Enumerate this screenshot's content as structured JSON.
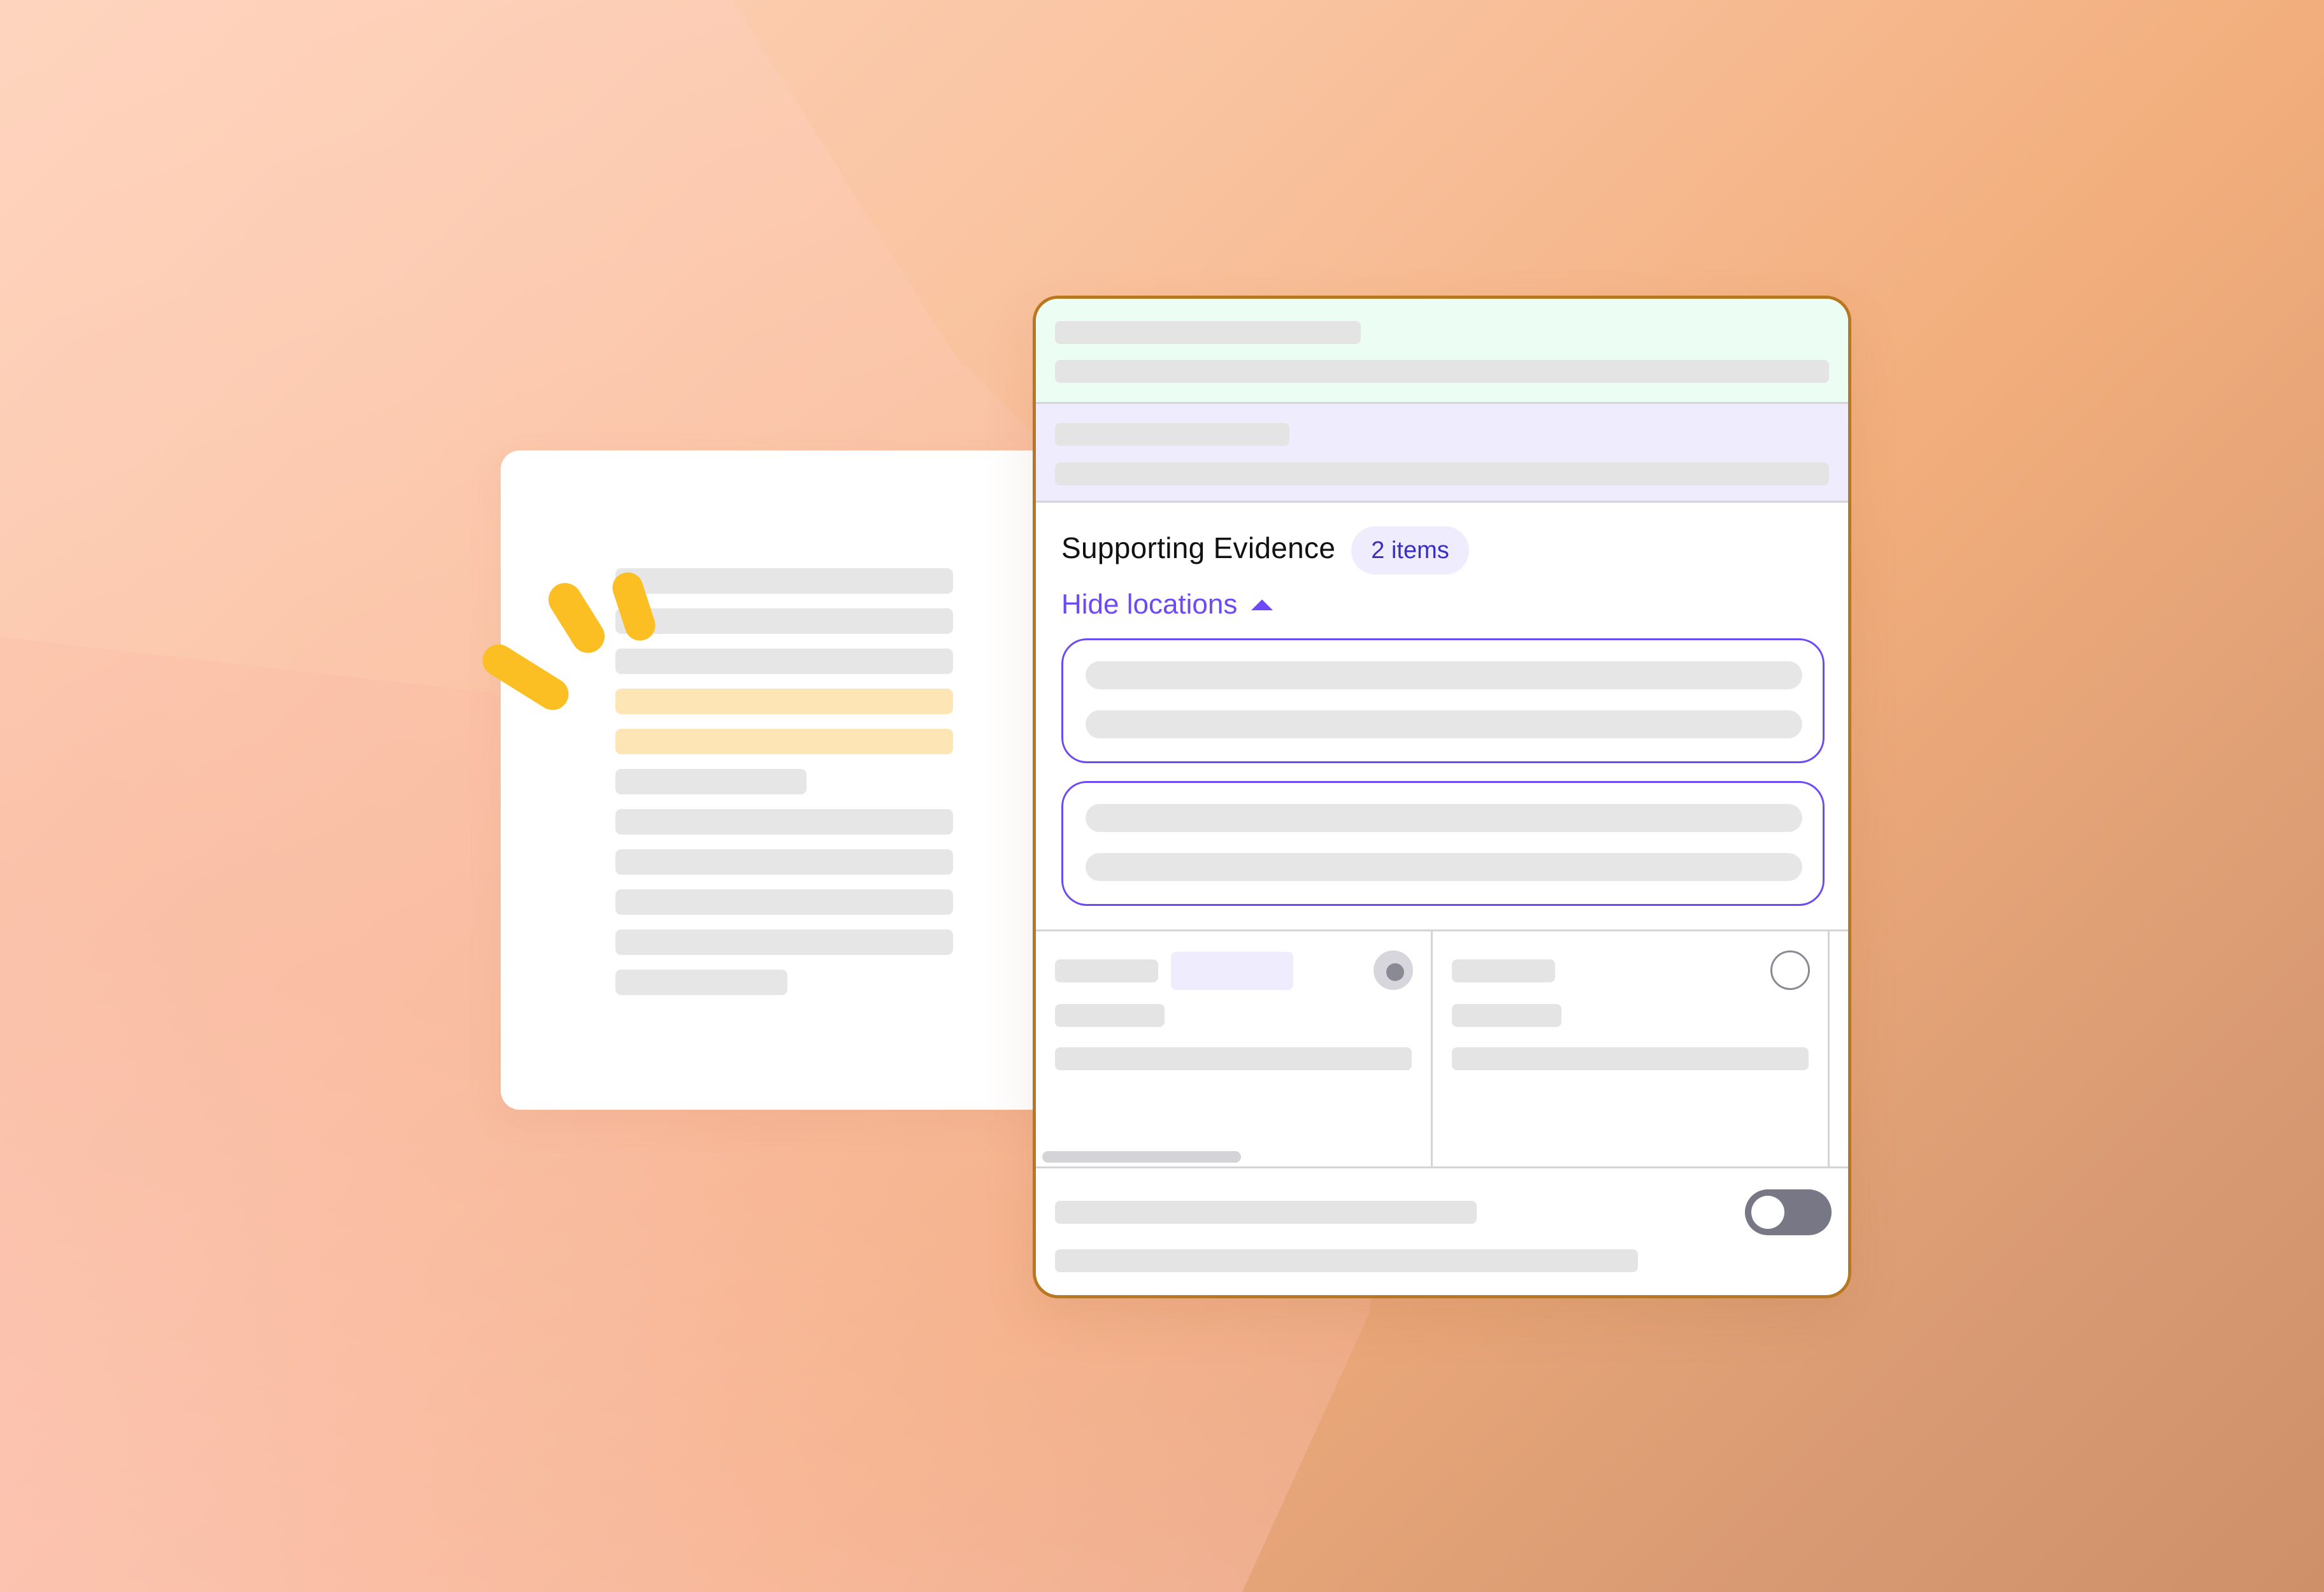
{
  "panel": {
    "evidence_title": "Supporting Evidence",
    "evidence_count": "2 items",
    "hide_locations_label": "Hide locations"
  },
  "options": {
    "first_selected": true,
    "second_selected": false
  },
  "toggle": {
    "on": false
  },
  "colors": {
    "accent": "#6d4af5",
    "panel_border": "#b8781f",
    "highlight": "#fde5b6",
    "sparkle": "#fbbf24"
  },
  "icons": [
    "caret-up-icon",
    "sparkle-icon",
    "radio-icon",
    "toggle-switch"
  ]
}
